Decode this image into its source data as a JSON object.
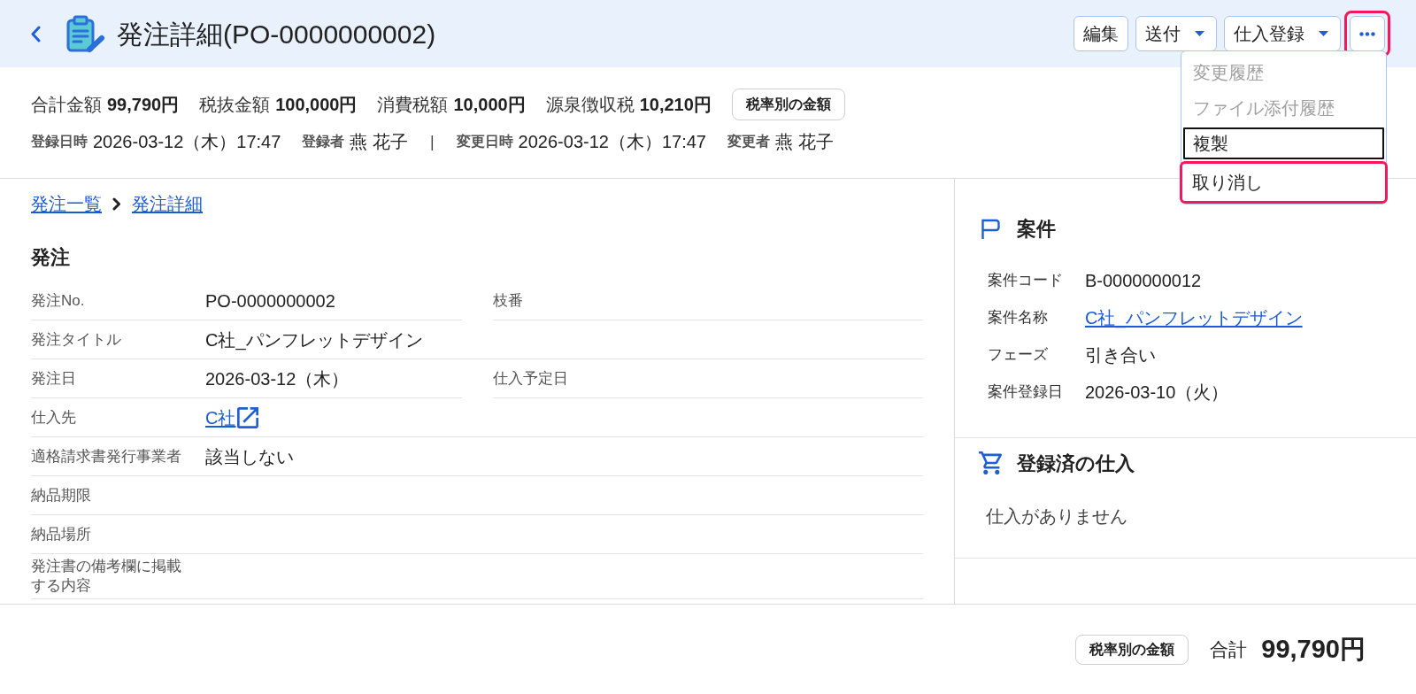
{
  "header": {
    "title": "発注詳細(PO-0000000002)",
    "actions": [
      {
        "kind": "button",
        "label": "編集",
        "highlighted": false
      },
      {
        "kind": "dropdown",
        "label": "送付",
        "highlighted": false
      },
      {
        "kind": "dropdown",
        "label": "仕入登録",
        "highlighted": false
      },
      {
        "kind": "more",
        "highlighted": true
      }
    ]
  },
  "action_menu": {
    "items": [
      {
        "label": "変更履歴",
        "disabled": true,
        "focused": false,
        "highlighted": false
      },
      {
        "label": "ファイル添付履歴",
        "disabled": true,
        "focused": false,
        "highlighted": false
      },
      {
        "label": "複製",
        "disabled": false,
        "focused": true,
        "highlighted": false
      },
      {
        "label": "取り消し",
        "disabled": false,
        "focused": false,
        "highlighted": true
      }
    ]
  },
  "summary": {
    "amounts": [
      {
        "label": "合計金額",
        "value": "99,790円"
      },
      {
        "label": "税抜金額",
        "value": "100,000円"
      },
      {
        "label": "消費税額",
        "value": "10,000円"
      },
      {
        "label": "源泉徴収税",
        "value": "10,210円"
      }
    ],
    "tax_button": "税率別の金額",
    "meta_groups": [
      {
        "items": [
          {
            "label": "登録日時",
            "value": "2026-03-12（木）17:47"
          },
          {
            "label": "登録者",
            "value": "燕 花子"
          }
        ]
      },
      {
        "items": [
          {
            "label": "変更日時",
            "value": "2026-03-12（木）17:47"
          },
          {
            "label": "変更者",
            "value": "燕 花子"
          }
        ]
      }
    ],
    "meta_separator": "|"
  },
  "breadcrumb": [
    {
      "label": "発注一覧"
    },
    {
      "label": "発注詳細"
    }
  ],
  "order": {
    "heading": "発注",
    "rows": [
      {
        "cells": [
          {
            "label": "発注No.",
            "value": "PO-0000000002",
            "kind": "text"
          },
          {
            "label": "枝番"
          }
        ]
      },
      {
        "cells": [
          {
            "label": "発注タイトル",
            "value": "C社_パンフレットデザイン",
            "kind": "text"
          }
        ]
      },
      {
        "cells": [
          {
            "label": "発注日",
            "value": "2026-03-12（木）",
            "kind": "text"
          },
          {
            "label": "仕入予定日"
          }
        ]
      },
      {
        "cells": [
          {
            "label": "仕入先",
            "value": "C社",
            "kind": "link"
          }
        ]
      },
      {
        "cells": [
          {
            "label": "適格請求書発行事業者",
            "value": "該当しない",
            "kind": "text"
          }
        ]
      },
      {
        "cells": [
          {
            "label": "納品期限"
          }
        ]
      },
      {
        "cells": [
          {
            "label": "納品場所"
          }
        ]
      },
      {
        "cells": [
          {
            "label": "発注書の備考欄に掲載する内容"
          }
        ]
      }
    ]
  },
  "project": {
    "heading": "案件",
    "fields": [
      {
        "label": "案件コード",
        "value": "B-0000000012",
        "kind": "text"
      },
      {
        "label": "案件名称",
        "value": "C社_パンフレットデザイン",
        "kind": "link"
      },
      {
        "label": "フェーズ",
        "value": "引き合い",
        "kind": "text"
      },
      {
        "label": "案件登録日",
        "value": "2026-03-10（火）",
        "kind": "text"
      }
    ]
  },
  "purchases": {
    "heading": "登録済の仕入",
    "empty_message": "仕入がありません"
  },
  "footer": {
    "tax_button": "税率別の金額",
    "total_label": "合計",
    "total_value": "99,790円"
  }
}
